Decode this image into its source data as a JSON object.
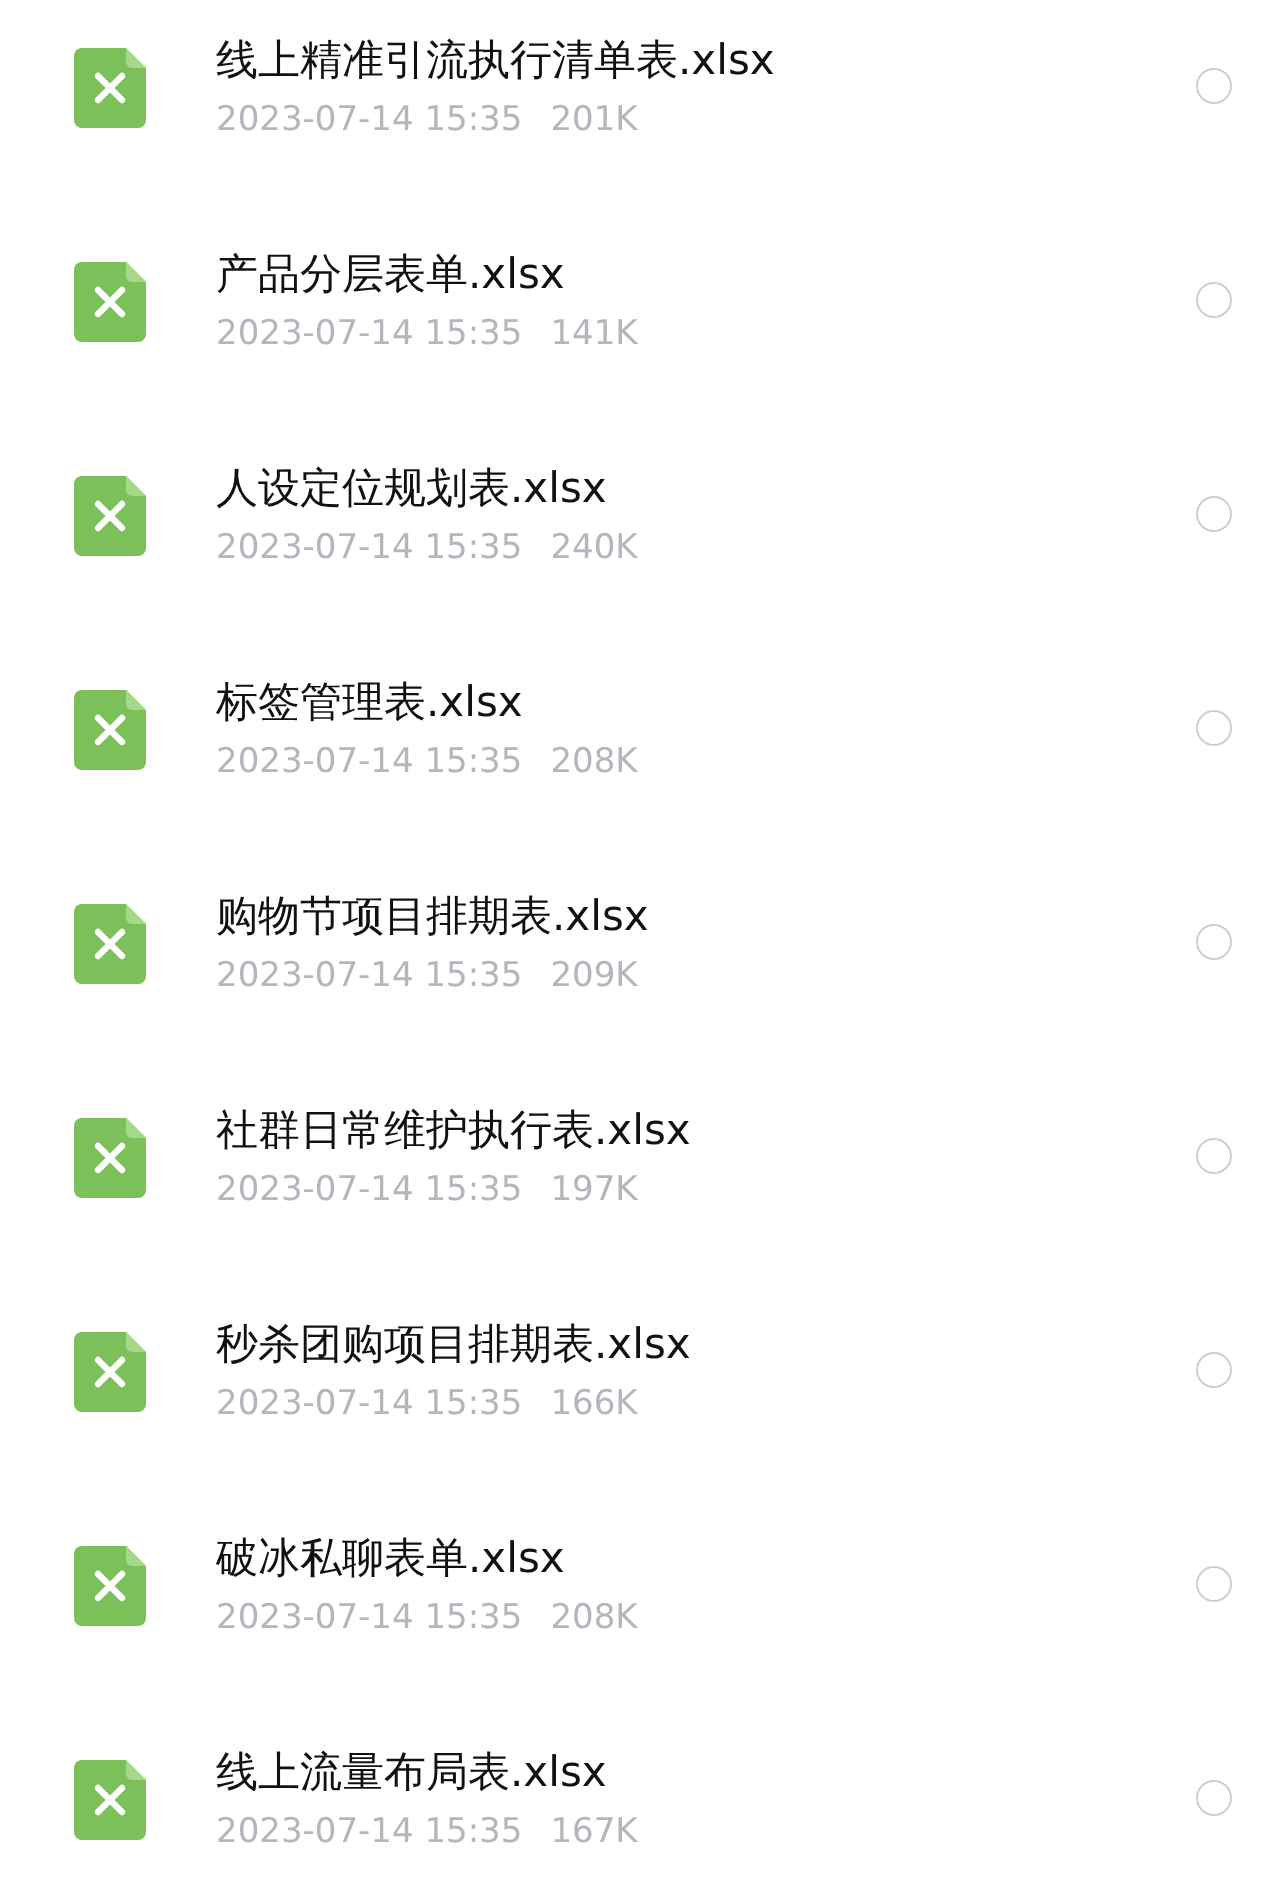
{
  "files": [
    {
      "name": "线上精准引流执行清单表.xlsx",
      "time": "2023-07-14 15:35",
      "size": "201K",
      "selected": false
    },
    {
      "name": "产品分层表单.xlsx",
      "time": "2023-07-14 15:35",
      "size": "141K",
      "selected": false
    },
    {
      "name": "人设定位规划表.xlsx",
      "time": "2023-07-14 15:35",
      "size": "240K",
      "selected": false
    },
    {
      "name": "标签管理表.xlsx",
      "time": "2023-07-14 15:35",
      "size": "208K",
      "selected": false
    },
    {
      "name": "购物节项目排期表.xlsx",
      "time": "2023-07-14 15:35",
      "size": "209K",
      "selected": false
    },
    {
      "name": "社群日常维护执行表.xlsx",
      "time": "2023-07-14 15:35",
      "size": "197K",
      "selected": false
    },
    {
      "name": "秒杀团购项目排期表.xlsx",
      "time": "2023-07-14 15:35",
      "size": "166K",
      "selected": false
    },
    {
      "name": "破冰私聊表单.xlsx",
      "time": "2023-07-14 15:35",
      "size": "208K",
      "selected": false
    },
    {
      "name": "线上流量布局表.xlsx",
      "time": "2023-07-14 15:35",
      "size": "167K",
      "selected": false
    }
  ]
}
